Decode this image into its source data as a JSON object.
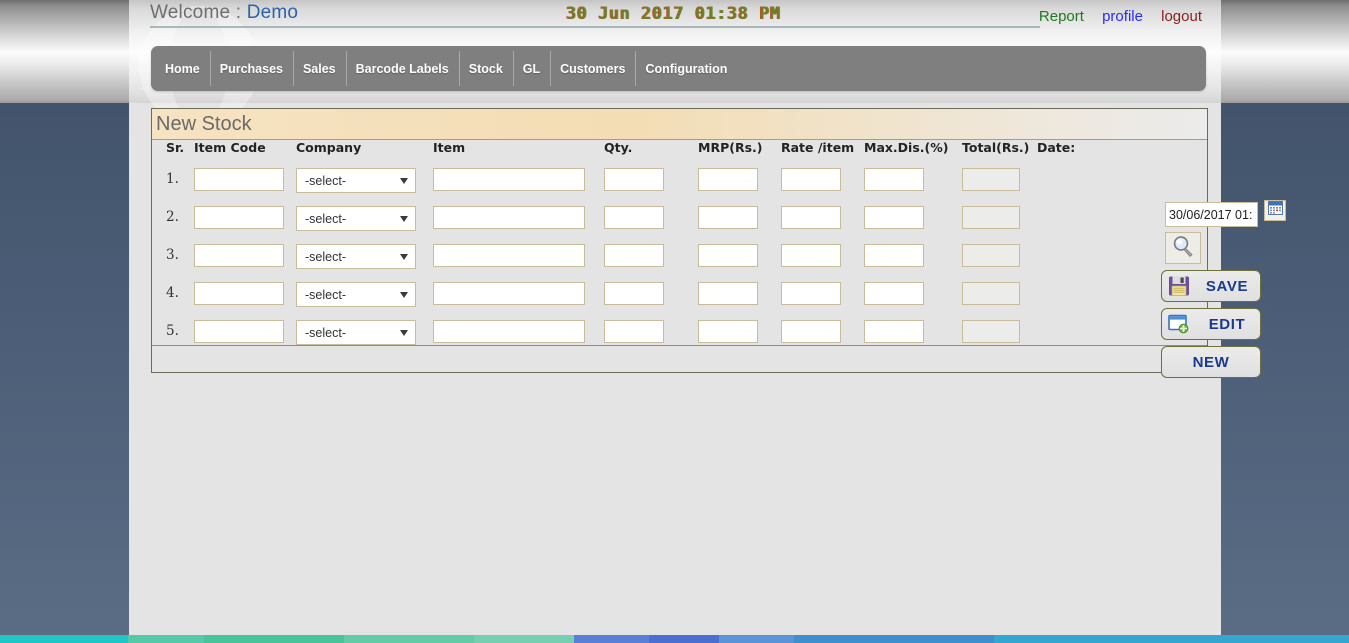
{
  "header": {
    "welcome_label": "Welcome : ",
    "user_name": "Demo",
    "datetime": "30 Jun 2017 01:38 PM",
    "links": [
      {
        "label": "Report",
        "name": "report"
      },
      {
        "label": "profile",
        "name": "profile"
      },
      {
        "label": "logout",
        "name": "logout"
      }
    ]
  },
  "nav": {
    "items": [
      {
        "label": "Home"
      },
      {
        "label": "Purchases"
      },
      {
        "label": "Sales"
      },
      {
        "label": "Barcode Labels"
      },
      {
        "label": "Stock"
      },
      {
        "label": "GL"
      },
      {
        "label": "Customers"
      },
      {
        "label": "Configuration"
      }
    ]
  },
  "panel": {
    "title": "New Stock",
    "columns": [
      {
        "key": "sr",
        "label": "Sr."
      },
      {
        "key": "code",
        "label": "Item Code"
      },
      {
        "key": "company",
        "label": "Company"
      },
      {
        "key": "item",
        "label": "Item"
      },
      {
        "key": "qty",
        "label": "Qty."
      },
      {
        "key": "mrp",
        "label": "MRP(Rs.)"
      },
      {
        "key": "rate",
        "label": "Rate /item"
      },
      {
        "key": "maxdis",
        "label": "Max.Dis.(%)"
      },
      {
        "key": "total",
        "label": "Total(Rs.)"
      },
      {
        "key": "date",
        "label": "Date:"
      }
    ],
    "select_placeholder": "-select-",
    "rows": [
      {
        "sr": "1.",
        "code": "",
        "company": "-select-",
        "item": "",
        "qty": "",
        "mrp": "",
        "rate": "",
        "maxdis": "",
        "total": ""
      },
      {
        "sr": "2.",
        "code": "",
        "company": "-select-",
        "item": "",
        "qty": "",
        "mrp": "",
        "rate": "",
        "maxdis": "",
        "total": ""
      },
      {
        "sr": "3.",
        "code": "",
        "company": "-select-",
        "item": "",
        "qty": "",
        "mrp": "",
        "rate": "",
        "maxdis": "",
        "total": ""
      },
      {
        "sr": "4.",
        "code": "",
        "company": "-select-",
        "item": "",
        "qty": "",
        "mrp": "",
        "rate": "",
        "maxdis": "",
        "total": ""
      },
      {
        "sr": "5.",
        "code": "",
        "company": "-select-",
        "item": "",
        "qty": "",
        "mrp": "",
        "rate": "",
        "maxdis": "",
        "total": ""
      }
    ],
    "date_value": "30/06/2017 01:",
    "buttons": {
      "save": "SAVE",
      "edit": "EDIT",
      "new": "NEW"
    },
    "icons": {
      "calendar": "calendar-icon",
      "search": "search-magnifier-icon",
      "save": "floppy-disk-icon",
      "edit": "window-add-icon"
    }
  },
  "colors": {
    "link_report": "#1f7a1f",
    "link_profile": "#2a2aff",
    "link_logout": "#8a1f1f",
    "datetime": "#7a7a22",
    "nav_bg": "#7f7f7f",
    "panel_title_bg": "#f3ddb4",
    "button_text": "#1b3a8c",
    "field_border": "#c9bc9b",
    "desktop_blue": "#4c5e77"
  }
}
